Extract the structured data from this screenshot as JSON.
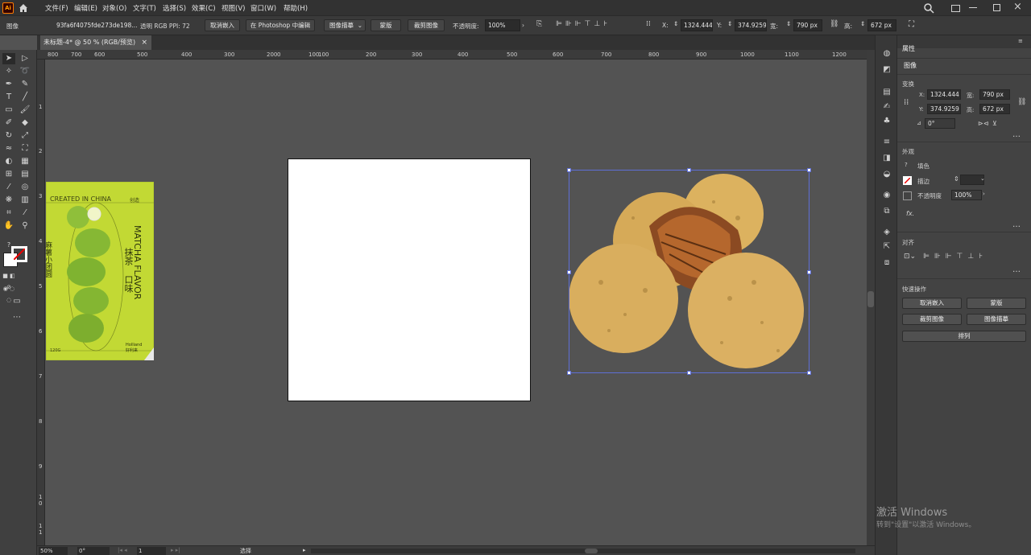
{
  "menubar": {
    "app_icon": "Ai",
    "items": [
      "文件(F)",
      "编辑(E)",
      "对象(O)",
      "文字(T)",
      "选择(S)",
      "效果(C)",
      "视图(V)",
      "窗口(W)",
      "帮助(H)"
    ]
  },
  "controlbar": {
    "object_type": "图像",
    "file_name": "93fa6f4075fde273de198...",
    "link_info": "透明 RGB  PPI: 72",
    "btn_unembed": "取消嵌入",
    "btn_photoshop": "在 Photoshop 中编辑",
    "btn_trace": "图像描摹",
    "btn_mask": "蒙版",
    "btn_crop": "裁剪图像",
    "opacity_label": "不透明度:",
    "opacity_value": "100%",
    "x_label": "X:",
    "x_value": "1324.4444",
    "y_label": "Y:",
    "y_value": "374.9259",
    "w_label": "宽:",
    "w_value": "790 px",
    "h_label": "高:",
    "h_value": "672 px"
  },
  "document_tab": {
    "title": "未标题-4* @ 50 % (RGB/预览)",
    "close": "×"
  },
  "ruler": {
    "h_ticks": [
      "800",
      "700",
      "600",
      "500",
      "400",
      "300",
      "200",
      "100",
      "0",
      "100",
      "200",
      "300",
      "400",
      "500",
      "600",
      "700",
      "800",
      "900",
      "1000",
      "1100",
      "1200",
      "1300",
      "1400",
      "1500",
      "1600",
      "1700",
      "1800"
    ],
    "v_ticks": [
      "1",
      "2",
      "3",
      "4",
      "5",
      "6",
      "7",
      "8",
      "9",
      "1 0",
      "1 1"
    ]
  },
  "package": {
    "brand_line": "CREATED IN CHINA",
    "brand_cn": "创造",
    "flavor_en": "MATCHA FLAVOR",
    "flavor_cn1": "抹茶",
    "flavor_cn2": "口味",
    "side_cn": "麻薯小团圆",
    "weight": "120G",
    "maker": "Holliand",
    "maker_cn": "好利来"
  },
  "status": {
    "zoom": "50%",
    "angle": "0°",
    "artboard_num": "1",
    "tool": "选择"
  },
  "properties": {
    "tab": "属性",
    "object_type": "图像",
    "transform_title": "变换",
    "x_label": "X:",
    "x_value": "1324.444",
    "y_label": "Y:",
    "y_value": "374.9259",
    "w_label": "宽:",
    "w_value": "790 px",
    "h_label": "高:",
    "h_value": "672 px",
    "angle_label": "⊿",
    "angle_value": "0°",
    "appearance_title": "外观",
    "fill_label": "填色",
    "stroke_label": "描边",
    "opacity_label": "不透明度",
    "opacity_value": "100%",
    "fx": "fx.",
    "align_title": "对齐",
    "quick_title": "快速操作",
    "btn_unembed": "取消嵌入",
    "btn_mask": "蒙版",
    "btn_crop": "裁剪图像",
    "btn_trace": "图像描摹",
    "btn_arrange": "排列"
  },
  "watermark": {
    "line1": "激活 Windows",
    "line2": "转到\"设置\"以激活 Windows。"
  },
  "colors": {
    "ui_dark": "#323232",
    "panel": "#434343",
    "canvas": "#535353",
    "selection": "#5e6fd6",
    "package_green": "#c4dc34",
    "cookie": "#d9ac5c"
  }
}
